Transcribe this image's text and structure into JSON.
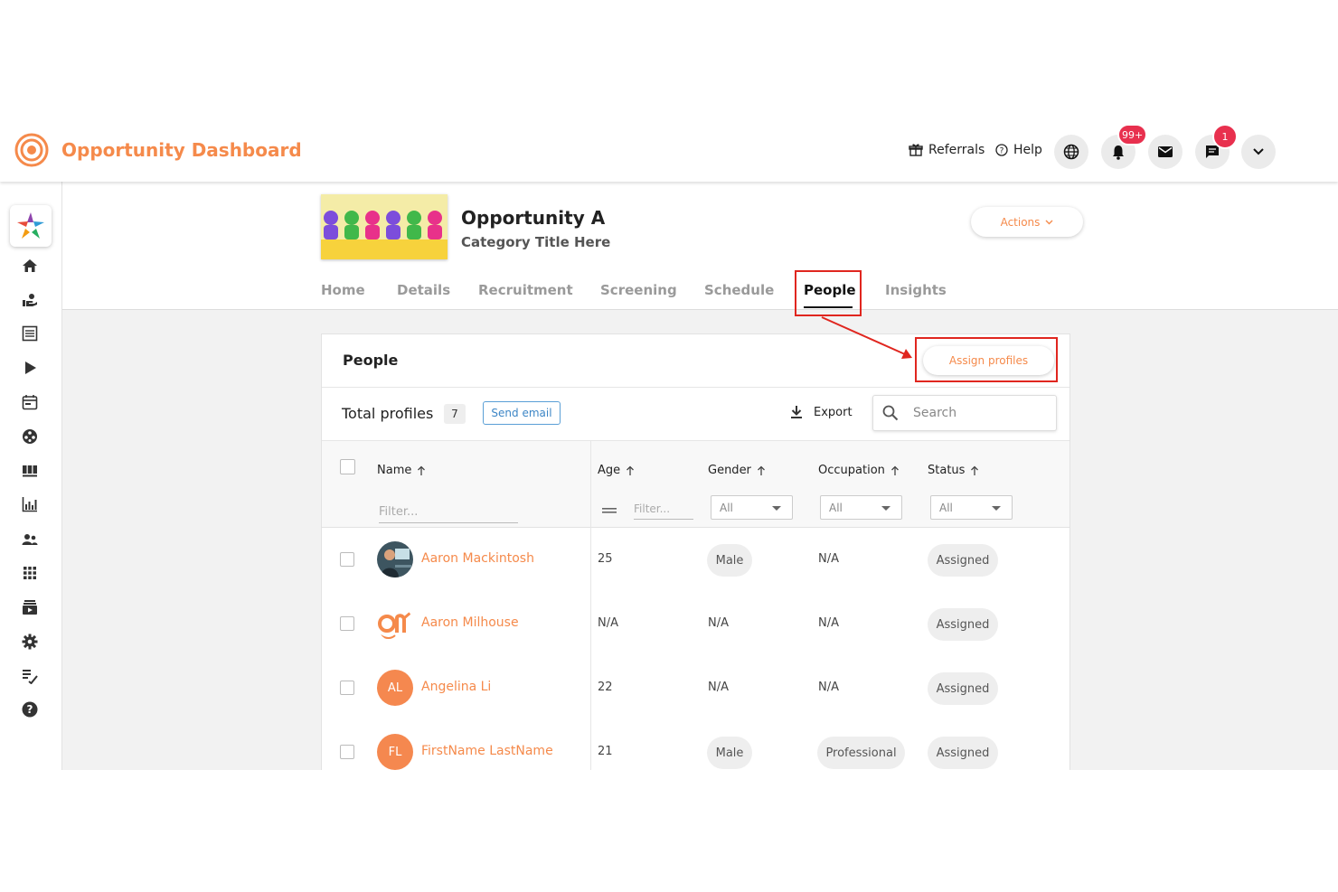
{
  "app": {
    "title": "Opportunity Dashboard"
  },
  "topnav": {
    "referrals": "Referrals",
    "help": "Help",
    "notifications_badge": "99+",
    "messages_badge": "1"
  },
  "opportunity": {
    "title": "Opportunity A",
    "subtitle": "Category Title Here",
    "actions_label": "Actions"
  },
  "tabs": [
    {
      "label": "Home"
    },
    {
      "label": "Details"
    },
    {
      "label": "Recruitment"
    },
    {
      "label": "Screening"
    },
    {
      "label": "Schedule"
    },
    {
      "label": "People",
      "active": true
    },
    {
      "label": "Insights"
    }
  ],
  "people": {
    "title": "People",
    "assign_label": "Assign profiles",
    "total_label": "Total profiles",
    "total_count": "7",
    "send_email_label": "Send email",
    "export_label": "Export",
    "search_placeholder": "Search",
    "columns": [
      "Name",
      "Age",
      "Gender",
      "Occupation",
      "Status"
    ],
    "filter_placeholder": "Filter...",
    "select_all": "All",
    "rows": [
      {
        "name": "Aaron Mackintosh",
        "age": "25",
        "gender": "Male",
        "occupation": "N/A",
        "status": "Assigned",
        "avatar": "photo"
      },
      {
        "name": "Aaron Milhouse",
        "age": "N/A",
        "gender": "N/A",
        "occupation": "N/A",
        "status": "Assigned",
        "avatar": "logo"
      },
      {
        "name": "Angelina Li",
        "age": "22",
        "gender": "N/A",
        "occupation": "N/A",
        "status": "Assigned",
        "avatar": "initials",
        "initials": "AL"
      },
      {
        "name": "FirstName LastName",
        "age": "21",
        "gender": "Male",
        "occupation": "Professional",
        "status": "Assigned",
        "avatar": "initials",
        "initials": "FL"
      }
    ]
  },
  "colors": {
    "brand": "#f58a4b",
    "highlight": "#e0261f",
    "badge": "#e8304e",
    "link_blue": "#3d86c6"
  }
}
